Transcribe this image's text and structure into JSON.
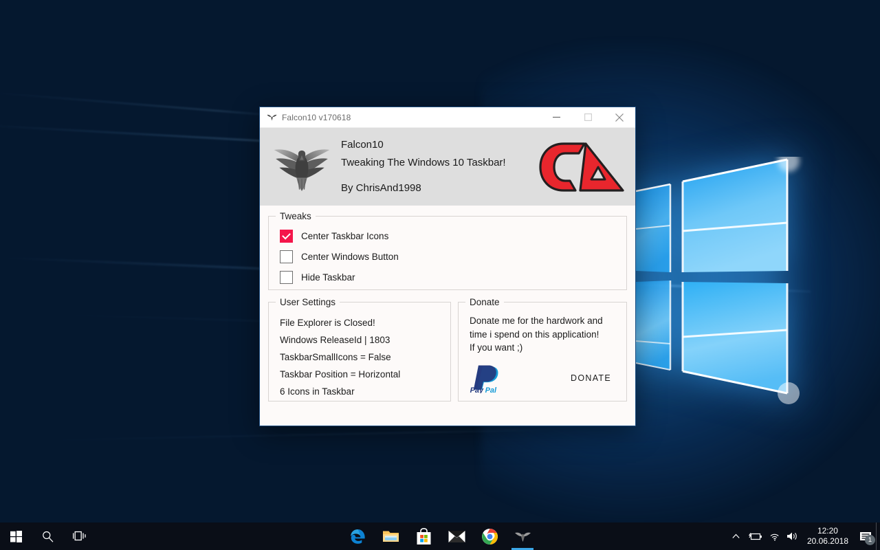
{
  "window": {
    "title": "Falcon10 v170618",
    "title_icon": "falcon-icon",
    "minimize_label": "—",
    "maximize_label": "□",
    "close_label": "✕"
  },
  "header": {
    "app_name": "Falcon10",
    "tagline": "Tweaking The Windows 10 Taskbar!",
    "author": "By ChrisAnd1998",
    "logo_text": "CA",
    "logo_color": "#e8262d",
    "falcon_icon": "falcon-logo-icon",
    "background": "#dedede"
  },
  "tweaks": {
    "legend": "Tweaks",
    "items": [
      {
        "label": "Center Taskbar Icons",
        "checked": true
      },
      {
        "label": "Center Windows Button",
        "checked": false
      },
      {
        "label": "Hide Taskbar",
        "checked": false
      }
    ],
    "checked_color": "#f4164a"
  },
  "user_settings": {
    "legend": "User Settings",
    "lines": [
      "File Explorer is Closed!",
      "Windows ReleaseId | 1803",
      "TaskbarSmallIcons = False",
      "Taskbar Position = Horizontal",
      "6 Icons in Taskbar"
    ]
  },
  "donate": {
    "legend": "Donate",
    "text_line1": "Donate me for the hardwork and",
    "text_line2": "time i spend on this application!",
    "text_line3": "If you want ;)",
    "paypal_label": "PayPal",
    "button_label": "DONATE"
  },
  "taskbar": {
    "start_label": "Start",
    "search_label": "Search",
    "taskview_label": "Task View",
    "apps": [
      {
        "name": "Microsoft Edge",
        "icon": "edge-icon",
        "active": false
      },
      {
        "name": "File Explorer",
        "icon": "file-explorer-icon",
        "active": false
      },
      {
        "name": "Microsoft Store",
        "icon": "store-icon",
        "active": false
      },
      {
        "name": "Mail",
        "icon": "mail-icon",
        "active": false
      },
      {
        "name": "Google Chrome",
        "icon": "chrome-icon",
        "active": false
      },
      {
        "name": "Falcon10",
        "icon": "falcon-icon",
        "active": true
      }
    ],
    "tray": {
      "show_hidden_label": "Show hidden icons",
      "battery_label": "Battery",
      "network_label": "Network",
      "volume_label": "Volume",
      "time": "12:20",
      "date": "20.06.2018",
      "notification_count": "1"
    }
  }
}
